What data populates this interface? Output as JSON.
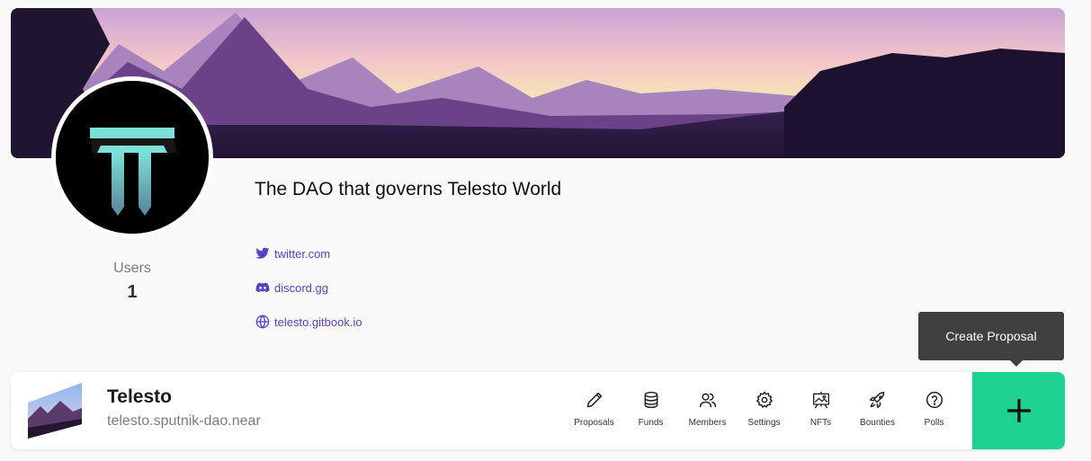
{
  "dao": {
    "description": "The DAO that governs Telesto World",
    "users_label": "Users",
    "users_count": "1",
    "name": "Telesto",
    "address": "telesto.sputnik-dao.near"
  },
  "links": [
    {
      "label": "twitter.com",
      "icon": "twitter-icon"
    },
    {
      "label": "discord.gg",
      "icon": "discord-icon"
    },
    {
      "label": "telesto.gitbook.io",
      "icon": "globe-icon"
    }
  ],
  "nav": {
    "proposals": "Proposals",
    "funds": "Funds",
    "members": "Members",
    "settings": "Settings",
    "nfts": "NFTs",
    "bounties": "Bounties",
    "polls": "Polls"
  },
  "tooltip": "Create Proposal",
  "colors": {
    "accent_green": "#1ed392",
    "link_purple": "#5b3fc8",
    "tooltip_bg": "#404040",
    "logo_teal": "#7be0d6"
  }
}
